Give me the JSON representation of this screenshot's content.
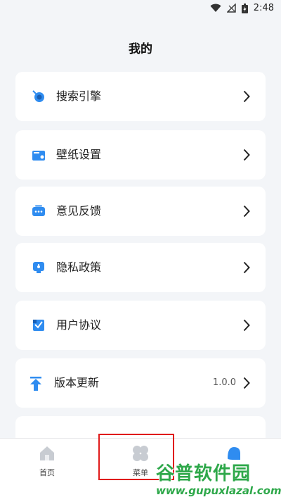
{
  "status_bar": {
    "time": "2:48",
    "icons": [
      "wifi-icon",
      "signal-icon",
      "battery-icon"
    ]
  },
  "header": {
    "title": "我的"
  },
  "menu": {
    "items": [
      {
        "label": "搜索引擎",
        "icon": "search-engine-icon"
      },
      {
        "label": "壁纸设置",
        "icon": "wallpaper-icon"
      },
      {
        "label": "意见反馈",
        "icon": "feedback-icon"
      },
      {
        "label": "隐私政策",
        "icon": "privacy-icon"
      },
      {
        "label": "用户协议",
        "icon": "agreement-icon"
      },
      {
        "label": "版本更新",
        "icon": "update-icon",
        "value": "1.0.0"
      }
    ]
  },
  "bottom_nav": {
    "items": [
      {
        "label": "首页",
        "icon": "home-icon"
      },
      {
        "label": "菜单",
        "icon": "menu-grid-icon"
      },
      {
        "label": "",
        "icon": "profile-icon"
      }
    ]
  },
  "watermark": {
    "title": "谷普软件园",
    "url": "www.gupuxlazal.com"
  },
  "colors": {
    "accent": "#2f8cf0",
    "background": "#f3f5f8",
    "highlight": "#e01b1b",
    "watermark": "#2ea84a"
  }
}
